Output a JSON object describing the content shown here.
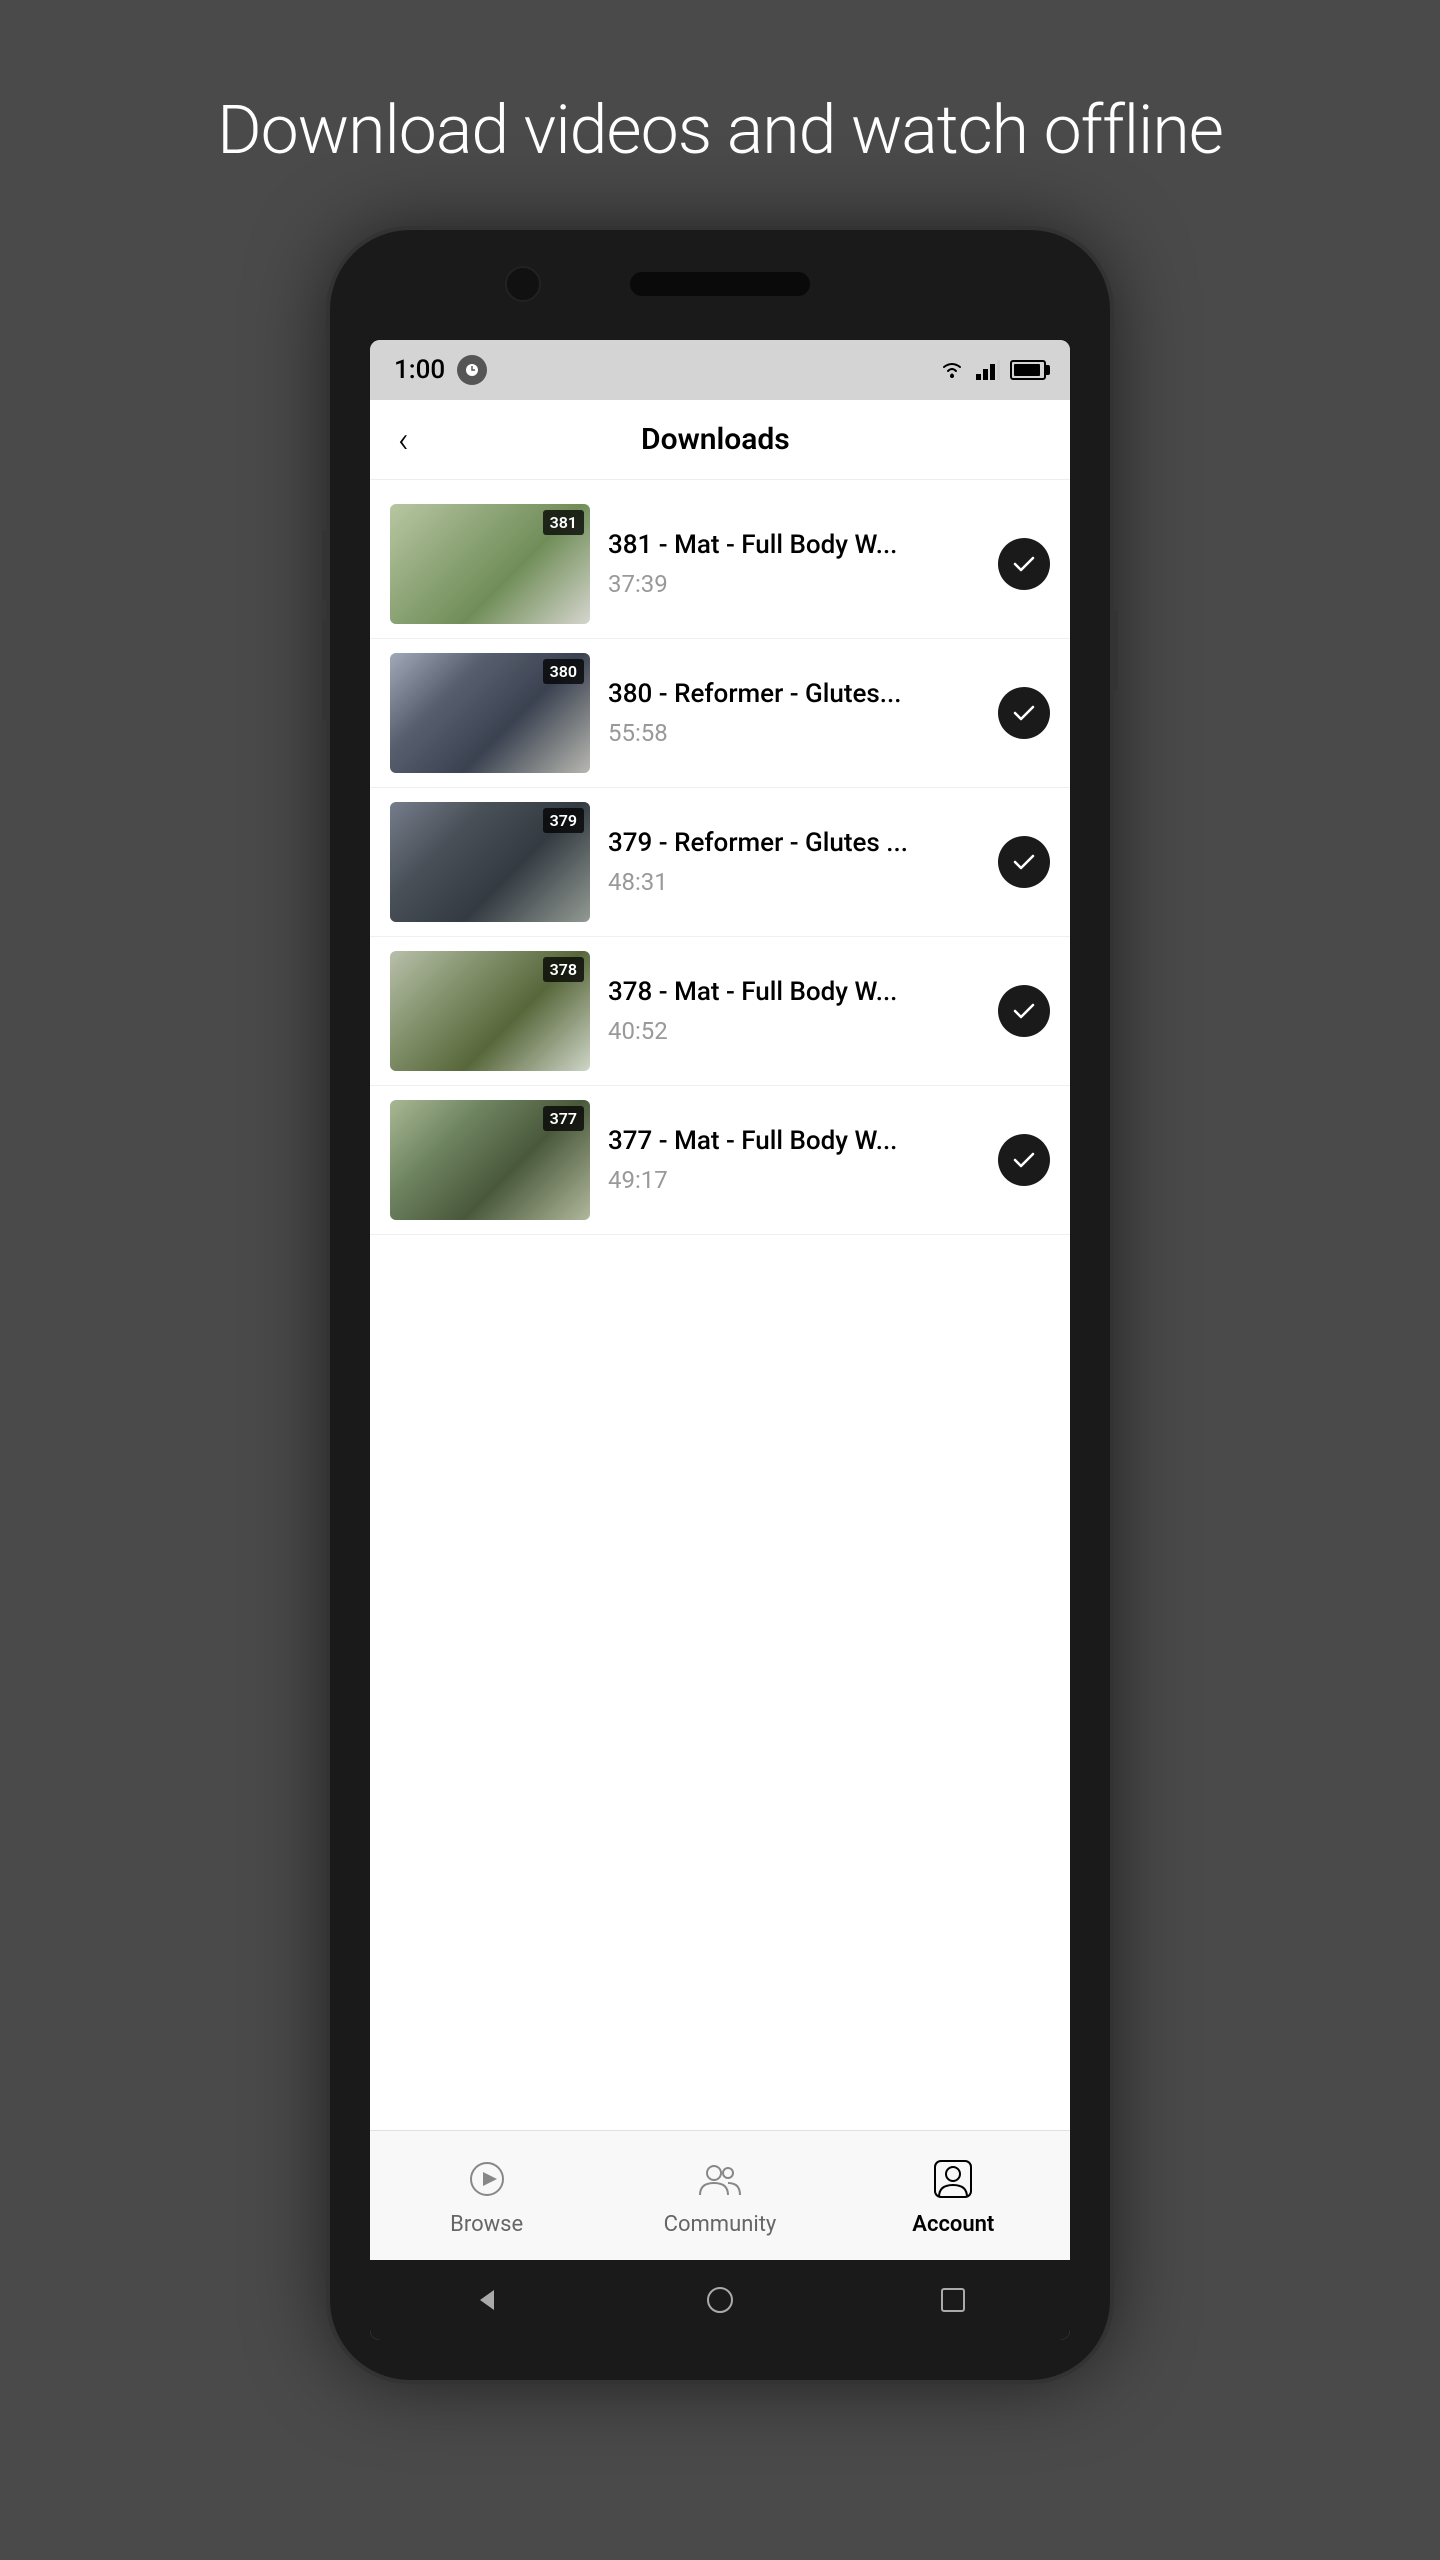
{
  "page": {
    "headline": "Download videos and watch offline"
  },
  "status_bar": {
    "time": "1:00",
    "wifi": "▼",
    "signal": "▲",
    "battery_pct": 80
  },
  "header": {
    "back_label": "‹",
    "title": "Downloads"
  },
  "downloads": [
    {
      "id": 381,
      "badge": "381",
      "title": "381 - Mat - Full Body W...",
      "duration": "37:39",
      "thumb_class": "thumb-381",
      "downloaded": true
    },
    {
      "id": 380,
      "badge": "380",
      "title": "380 - Reformer - Glutes...",
      "duration": "55:58",
      "thumb_class": "thumb-380",
      "downloaded": true
    },
    {
      "id": 379,
      "badge": "379",
      "title": "379 - Reformer - Glutes ...",
      "duration": "48:31",
      "thumb_class": "thumb-379",
      "downloaded": true
    },
    {
      "id": 378,
      "badge": "378",
      "title": "378 - Mat - Full Body W...",
      "duration": "40:52",
      "thumb_class": "thumb-378",
      "downloaded": true
    },
    {
      "id": 377,
      "badge": "377",
      "title": "377 - Mat - Full Body W...",
      "duration": "49:17",
      "thumb_class": "thumb-377",
      "downloaded": true
    }
  ],
  "bottom_nav": {
    "items": [
      {
        "id": "browse",
        "label": "Browse",
        "active": false,
        "icon": "browse-icon"
      },
      {
        "id": "community",
        "label": "Community",
        "active": false,
        "icon": "community-icon"
      },
      {
        "id": "account",
        "label": "Account",
        "active": true,
        "icon": "account-icon"
      }
    ]
  }
}
